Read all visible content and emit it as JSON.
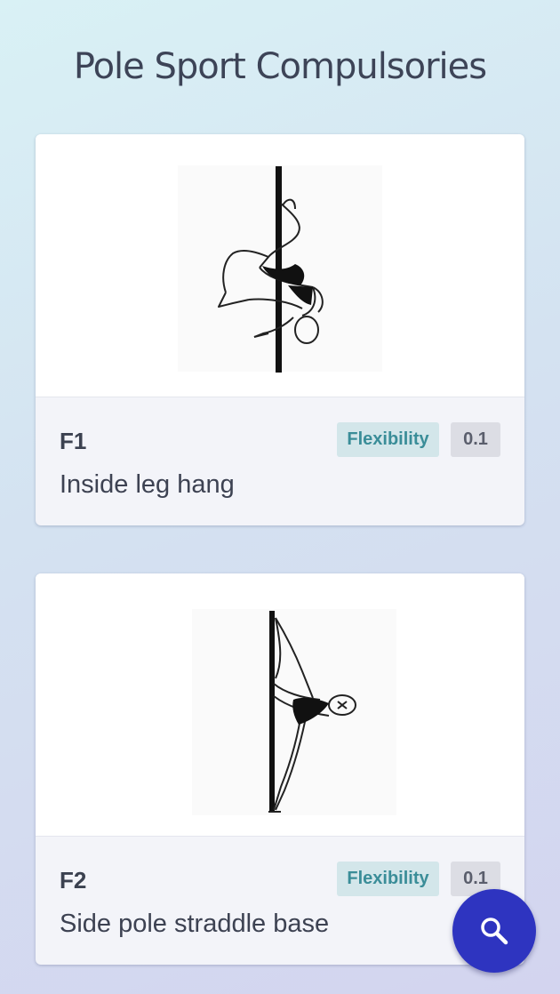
{
  "header": {
    "title": "Pole Sport Compulsories"
  },
  "cards": [
    {
      "code": "F1",
      "name": "Inside leg hang",
      "category": "Flexibility",
      "value": "0.1",
      "image_icon": "pole-figure-inside-leg-hang"
    },
    {
      "code": "F2",
      "name": "Side pole straddle base",
      "category": "Flexibility",
      "value": "0.1",
      "image_icon": "pole-figure-side-straddle"
    }
  ],
  "fab": {
    "icon": "search-icon"
  },
  "colors": {
    "accent": "#2e34c0",
    "category_tag_bg": "#d3e6ea",
    "category_tag_text": "#3a8d98",
    "value_tag_bg": "#dcdde4"
  }
}
